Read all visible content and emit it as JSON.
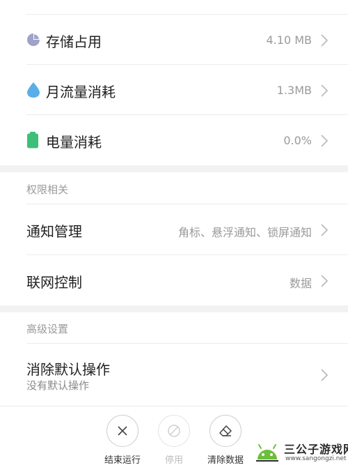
{
  "usage": {
    "storage": {
      "label": "存储占用",
      "value": "4.10 MB"
    },
    "data": {
      "label": "月流量消耗",
      "value": "1.3MB"
    },
    "battery": {
      "label": "电量消耗",
      "value": "0.0%"
    }
  },
  "permissions": {
    "header": "权限相关",
    "notifications": {
      "label": "通知管理",
      "value": "角标、悬浮通知、锁屏通知"
    },
    "network": {
      "label": "联网控制",
      "value": "数据"
    }
  },
  "advanced": {
    "header": "高级设置",
    "clear_defaults": {
      "label": "消除默认操作",
      "sub": "没有默认操作"
    }
  },
  "actions": {
    "force_stop": "结束运行",
    "disable": "停用",
    "clear_data": "清除数据"
  },
  "watermark": {
    "title": "三公子游戏网",
    "url": "www.sangongzi.net"
  },
  "colors": {
    "storage_icon": "#9fa3c9",
    "data_icon": "#5aaee8",
    "battery_icon": "#3dbf7a"
  }
}
